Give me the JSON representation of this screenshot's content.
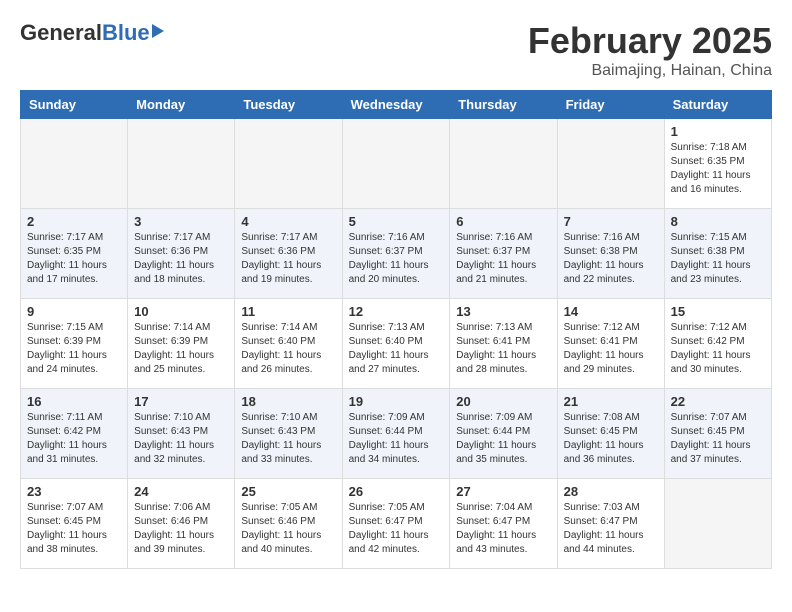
{
  "header": {
    "logo_general": "General",
    "logo_blue": "Blue",
    "month_title": "February 2025",
    "location": "Baimajing, Hainan, China"
  },
  "days_of_week": [
    "Sunday",
    "Monday",
    "Tuesday",
    "Wednesday",
    "Thursday",
    "Friday",
    "Saturday"
  ],
  "weeks": [
    {
      "alt": false,
      "days": [
        {
          "num": "",
          "info": ""
        },
        {
          "num": "",
          "info": ""
        },
        {
          "num": "",
          "info": ""
        },
        {
          "num": "",
          "info": ""
        },
        {
          "num": "",
          "info": ""
        },
        {
          "num": "",
          "info": ""
        },
        {
          "num": "1",
          "info": "Sunrise: 7:18 AM\nSunset: 6:35 PM\nDaylight: 11 hours and 16 minutes."
        }
      ]
    },
    {
      "alt": true,
      "days": [
        {
          "num": "2",
          "info": "Sunrise: 7:17 AM\nSunset: 6:35 PM\nDaylight: 11 hours and 17 minutes."
        },
        {
          "num": "3",
          "info": "Sunrise: 7:17 AM\nSunset: 6:36 PM\nDaylight: 11 hours and 18 minutes."
        },
        {
          "num": "4",
          "info": "Sunrise: 7:17 AM\nSunset: 6:36 PM\nDaylight: 11 hours and 19 minutes."
        },
        {
          "num": "5",
          "info": "Sunrise: 7:16 AM\nSunset: 6:37 PM\nDaylight: 11 hours and 20 minutes."
        },
        {
          "num": "6",
          "info": "Sunrise: 7:16 AM\nSunset: 6:37 PM\nDaylight: 11 hours and 21 minutes."
        },
        {
          "num": "7",
          "info": "Sunrise: 7:16 AM\nSunset: 6:38 PM\nDaylight: 11 hours and 22 minutes."
        },
        {
          "num": "8",
          "info": "Sunrise: 7:15 AM\nSunset: 6:38 PM\nDaylight: 11 hours and 23 minutes."
        }
      ]
    },
    {
      "alt": false,
      "days": [
        {
          "num": "9",
          "info": "Sunrise: 7:15 AM\nSunset: 6:39 PM\nDaylight: 11 hours and 24 minutes."
        },
        {
          "num": "10",
          "info": "Sunrise: 7:14 AM\nSunset: 6:39 PM\nDaylight: 11 hours and 25 minutes."
        },
        {
          "num": "11",
          "info": "Sunrise: 7:14 AM\nSunset: 6:40 PM\nDaylight: 11 hours and 26 minutes."
        },
        {
          "num": "12",
          "info": "Sunrise: 7:13 AM\nSunset: 6:40 PM\nDaylight: 11 hours and 27 minutes."
        },
        {
          "num": "13",
          "info": "Sunrise: 7:13 AM\nSunset: 6:41 PM\nDaylight: 11 hours and 28 minutes."
        },
        {
          "num": "14",
          "info": "Sunrise: 7:12 AM\nSunset: 6:41 PM\nDaylight: 11 hours and 29 minutes."
        },
        {
          "num": "15",
          "info": "Sunrise: 7:12 AM\nSunset: 6:42 PM\nDaylight: 11 hours and 30 minutes."
        }
      ]
    },
    {
      "alt": true,
      "days": [
        {
          "num": "16",
          "info": "Sunrise: 7:11 AM\nSunset: 6:42 PM\nDaylight: 11 hours and 31 minutes."
        },
        {
          "num": "17",
          "info": "Sunrise: 7:10 AM\nSunset: 6:43 PM\nDaylight: 11 hours and 32 minutes."
        },
        {
          "num": "18",
          "info": "Sunrise: 7:10 AM\nSunset: 6:43 PM\nDaylight: 11 hours and 33 minutes."
        },
        {
          "num": "19",
          "info": "Sunrise: 7:09 AM\nSunset: 6:44 PM\nDaylight: 11 hours and 34 minutes."
        },
        {
          "num": "20",
          "info": "Sunrise: 7:09 AM\nSunset: 6:44 PM\nDaylight: 11 hours and 35 minutes."
        },
        {
          "num": "21",
          "info": "Sunrise: 7:08 AM\nSunset: 6:45 PM\nDaylight: 11 hours and 36 minutes."
        },
        {
          "num": "22",
          "info": "Sunrise: 7:07 AM\nSunset: 6:45 PM\nDaylight: 11 hours and 37 minutes."
        }
      ]
    },
    {
      "alt": false,
      "days": [
        {
          "num": "23",
          "info": "Sunrise: 7:07 AM\nSunset: 6:45 PM\nDaylight: 11 hours and 38 minutes."
        },
        {
          "num": "24",
          "info": "Sunrise: 7:06 AM\nSunset: 6:46 PM\nDaylight: 11 hours and 39 minutes."
        },
        {
          "num": "25",
          "info": "Sunrise: 7:05 AM\nSunset: 6:46 PM\nDaylight: 11 hours and 40 minutes."
        },
        {
          "num": "26",
          "info": "Sunrise: 7:05 AM\nSunset: 6:47 PM\nDaylight: 11 hours and 42 minutes."
        },
        {
          "num": "27",
          "info": "Sunrise: 7:04 AM\nSunset: 6:47 PM\nDaylight: 11 hours and 43 minutes."
        },
        {
          "num": "28",
          "info": "Sunrise: 7:03 AM\nSunset: 6:47 PM\nDaylight: 11 hours and 44 minutes."
        },
        {
          "num": "",
          "info": ""
        }
      ]
    }
  ]
}
